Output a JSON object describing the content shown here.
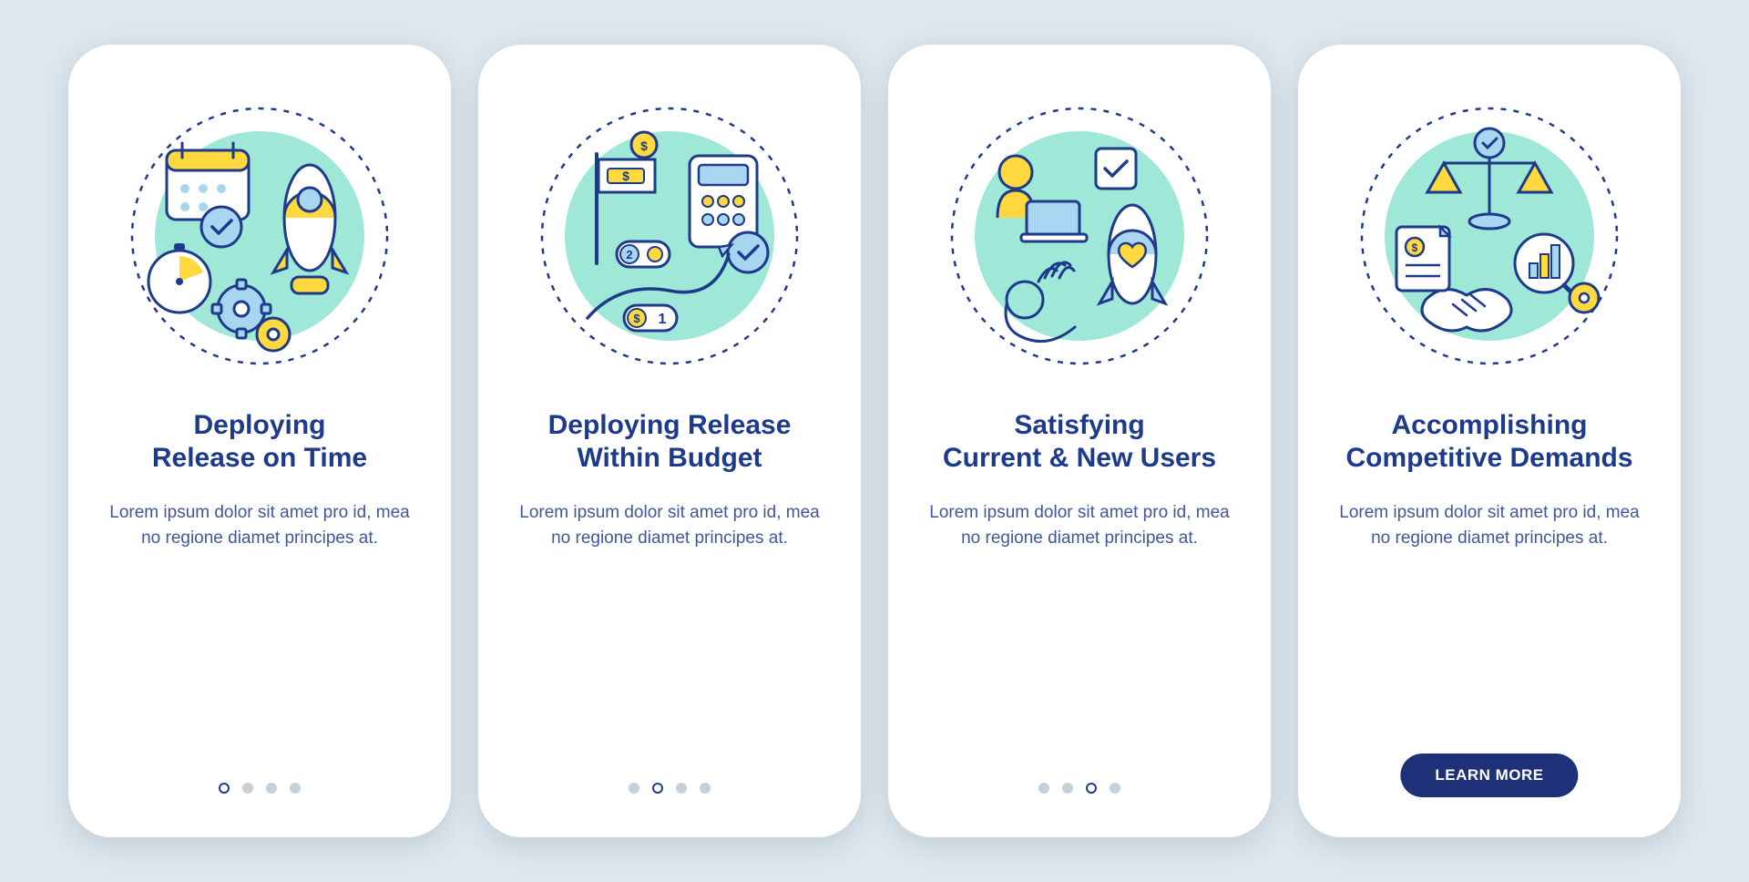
{
  "colors": {
    "navy": "#1e3a8a",
    "mint": "#9fe8d8",
    "yellow": "#ffd93d",
    "lightblue": "#a8d5f0",
    "background": "#dde7ed"
  },
  "screens": [
    {
      "title": "Deploying\nRelease on Time",
      "body": "Lorem ipsum dolor sit amet pro id, mea no regione diamet principes at.",
      "page_index": 0,
      "illustration": "time",
      "cta": null
    },
    {
      "title": "Deploying Release\nWithin Budget",
      "body": "Lorem ipsum dolor sit amet pro id, mea no regione diamet principes at.",
      "page_index": 1,
      "illustration": "budget",
      "cta": null
    },
    {
      "title": "Satisfying\nCurrent & New Users",
      "body": "Lorem ipsum dolor sit amet pro id, mea no regione diamet principes at.",
      "page_index": 2,
      "illustration": "users",
      "cta": null
    },
    {
      "title": "Accomplishing\nCompetitive Demands",
      "body": "Lorem ipsum dolor sit amet pro id, mea no regione diamet principes at.",
      "page_index": 3,
      "illustration": "competitive",
      "cta": "LEARN MORE"
    }
  ],
  "total_pages": 4
}
